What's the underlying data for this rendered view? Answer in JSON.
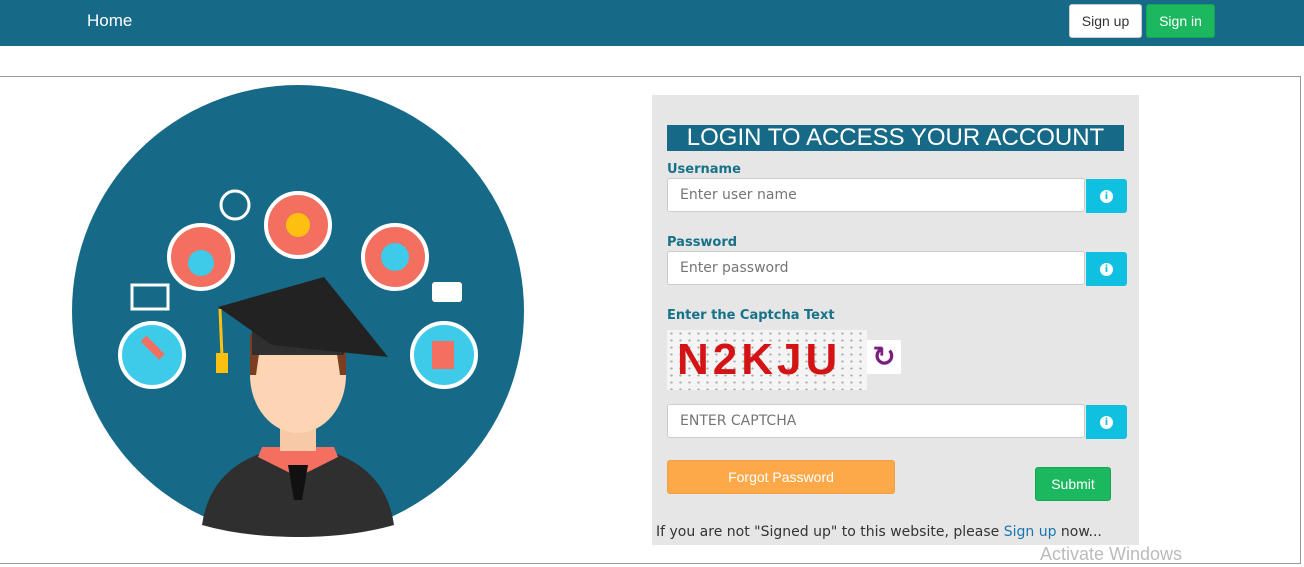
{
  "nav": {
    "home": "Home",
    "signup": "Sign up",
    "signin": "Sign in"
  },
  "login": {
    "title": "LOGIN TO ACCESS YOUR ACCOUNT",
    "username_label": "Username",
    "username_placeholder": "Enter user name",
    "password_label": "Password",
    "password_placeholder": "Enter password",
    "captcha_label": "Enter the Captcha Text",
    "captcha_text": "N2KJU",
    "captcha_placeholder": "ENTER CAPTCHA",
    "info_glyph": "i",
    "refresh_glyph": "↻",
    "forgot": "Forgot Password",
    "submit": "Submit",
    "note_prefix": "If you are not \"Signed up\" to this website, please ",
    "note_link": "Sign up",
    "note_suffix": " now..."
  },
  "watermark": "Activate Windows",
  "colors": {
    "nav": "#166a88",
    "success": "#1cb860",
    "info": "#0fc0e0",
    "warning": "#fda94a"
  }
}
